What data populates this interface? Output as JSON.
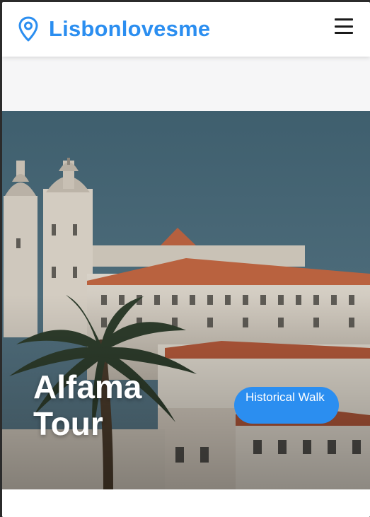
{
  "navbar": {
    "brand_name": "Lisbonlovesme",
    "brand_icon": "map-pin-icon",
    "menu_icon": "hamburger-menu-icon"
  },
  "hero": {
    "title": "Alfama Tour",
    "badge": "Historical Walk",
    "image": "Lisbon monastery on hillside with palm tree"
  },
  "colors": {
    "accent": "#2b8ef0",
    "navbar_bg": "#ffffff",
    "page_bg": "#f6f6f7",
    "hero_text": "#ffffff"
  }
}
